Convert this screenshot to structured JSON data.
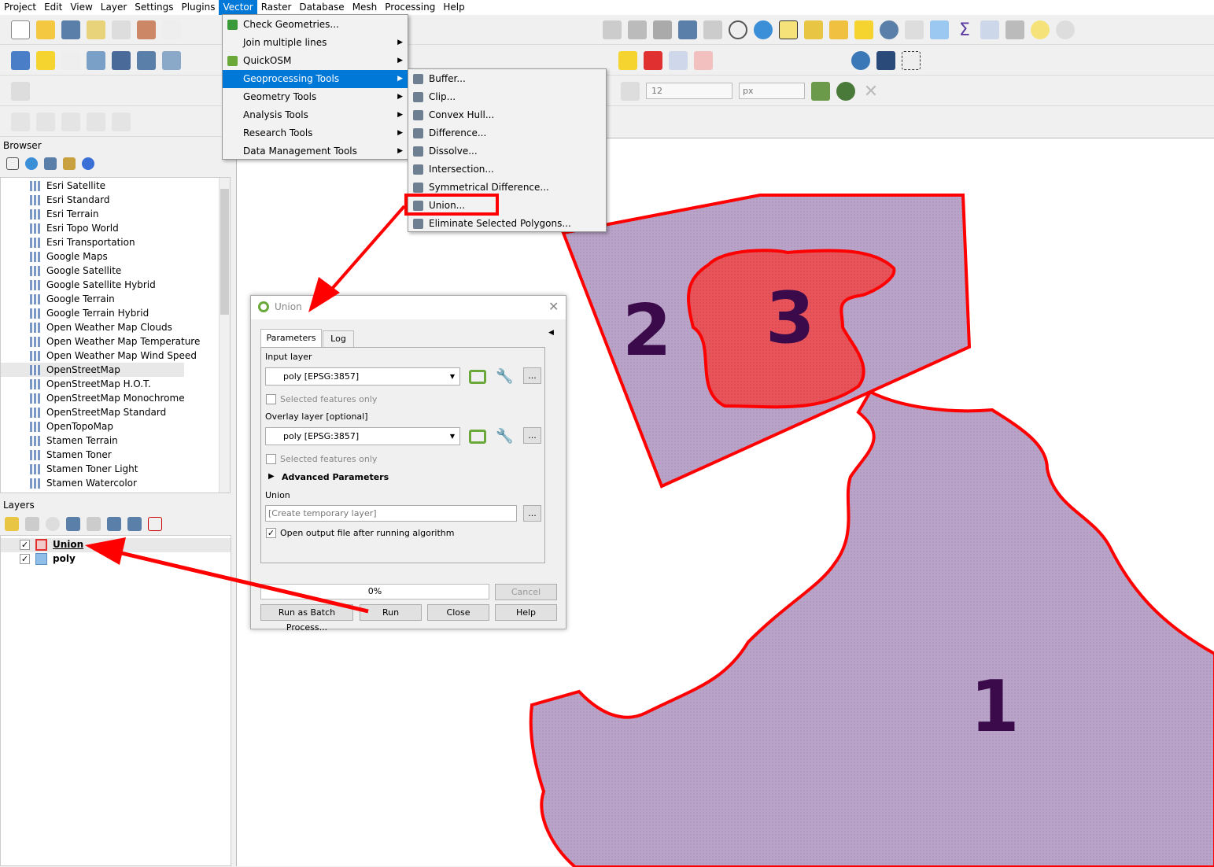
{
  "menubar": {
    "items": [
      "Project",
      "Edit",
      "View",
      "Layer",
      "Settings",
      "Plugins",
      "Vector",
      "Raster",
      "Database",
      "Mesh",
      "Processing",
      "Help"
    ],
    "active": "Vector"
  },
  "vector_menu": {
    "items": [
      {
        "label": "Check Geometries...",
        "icon": "check-geometries-icon",
        "submenu": false
      },
      {
        "label": "Join multiple lines",
        "submenu": true
      },
      {
        "label": "QuickOSM",
        "icon": "quickosm-icon",
        "submenu": true
      },
      {
        "label": "Geoprocessing Tools",
        "submenu": true,
        "selected": true
      },
      {
        "label": "Geometry Tools",
        "submenu": true
      },
      {
        "label": "Analysis Tools",
        "submenu": true
      },
      {
        "label": "Research Tools",
        "submenu": true
      },
      {
        "label": "Data Management Tools",
        "submenu": true
      }
    ]
  },
  "geoprocessing_menu": {
    "items": [
      "Buffer...",
      "Clip...",
      "Convex Hull...",
      "Difference...",
      "Dissolve...",
      "Intersection...",
      "Symmetrical Difference...",
      "Union...",
      "Eliminate Selected Polygons..."
    ],
    "highlighted": "Union..."
  },
  "toolbar": {
    "font_size": "12",
    "unit": "px"
  },
  "browser": {
    "title": "Browser",
    "items": [
      "Esri Satellite",
      "Esri Standard",
      "Esri Terrain",
      "Esri Topo World",
      "Esri Transportation",
      "Google Maps",
      "Google Satellite",
      "Google Satellite Hybrid",
      "Google Terrain",
      "Google Terrain Hybrid",
      "Open Weather Map Clouds",
      "Open Weather Map Temperature",
      "Open Weather Map Wind Speed",
      "OpenStreetMap",
      "OpenStreetMap H.O.T.",
      "OpenStreetMap Monochrome",
      "OpenStreetMap Standard",
      "OpenTopoMap",
      "Stamen Terrain",
      "Stamen Toner",
      "Stamen Toner Light",
      "Stamen Watercolor"
    ],
    "selected": "OpenStreetMap"
  },
  "layers": {
    "title": "Layers",
    "items": [
      {
        "name": "Union",
        "checked": true,
        "color": "#f2c9c9",
        "border": "#e03030"
      },
      {
        "name": "poly",
        "checked": true,
        "color": "#8fbfe8",
        "border": "#5a8fc0"
      }
    ]
  },
  "dialog": {
    "title": "Union",
    "tabs": [
      "Parameters",
      "Log"
    ],
    "input_layer_label": "Input layer",
    "input_layer_value": "poly [EPSG:3857]",
    "selected_only": "Selected features only",
    "overlay_label": "Overlay layer [optional]",
    "overlay_value": "poly [EPSG:3857]",
    "advanced": "Advanced Parameters",
    "output_label": "Union",
    "output_placeholder": "[Create temporary layer]",
    "open_output": "Open output file after running algorithm",
    "open_output_checked": true,
    "progress": "0%",
    "progress_value": 0,
    "cancel": "Cancel",
    "batch": "Run as Batch Process...",
    "run": "Run",
    "close": "Close",
    "help": "Help",
    "more": "..."
  },
  "map": {
    "labels": [
      "1",
      "2",
      "3"
    ],
    "fill": "#b9a3c8",
    "highlight_fill": "#e8545a",
    "stroke": "#ff0000",
    "label_color": "#3a0a4a"
  },
  "colors": {
    "accent": "#0078d7",
    "annotation": "#ff0000"
  }
}
